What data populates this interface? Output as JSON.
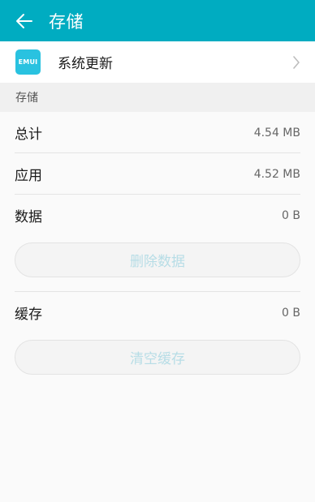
{
  "header": {
    "title": "存储",
    "back_icon": "arrow-left-icon",
    "background_color": "#00acc1"
  },
  "app": {
    "name": "系统更新",
    "icon_label": "EMUI",
    "icon_name": "emui-app-icon",
    "icon_color": "#29c2e0"
  },
  "storage": {
    "section_label": "存储",
    "total_label": "总计",
    "total_value": "4.54 MB",
    "app_label": "应用",
    "app_value": "4.52 MB",
    "data_label": "数据",
    "data_value": "0 B",
    "clear_data_label": "删除数据",
    "cache_label": "缓存",
    "cache_value": "0 B",
    "clear_cache_label": "清空缓存"
  }
}
